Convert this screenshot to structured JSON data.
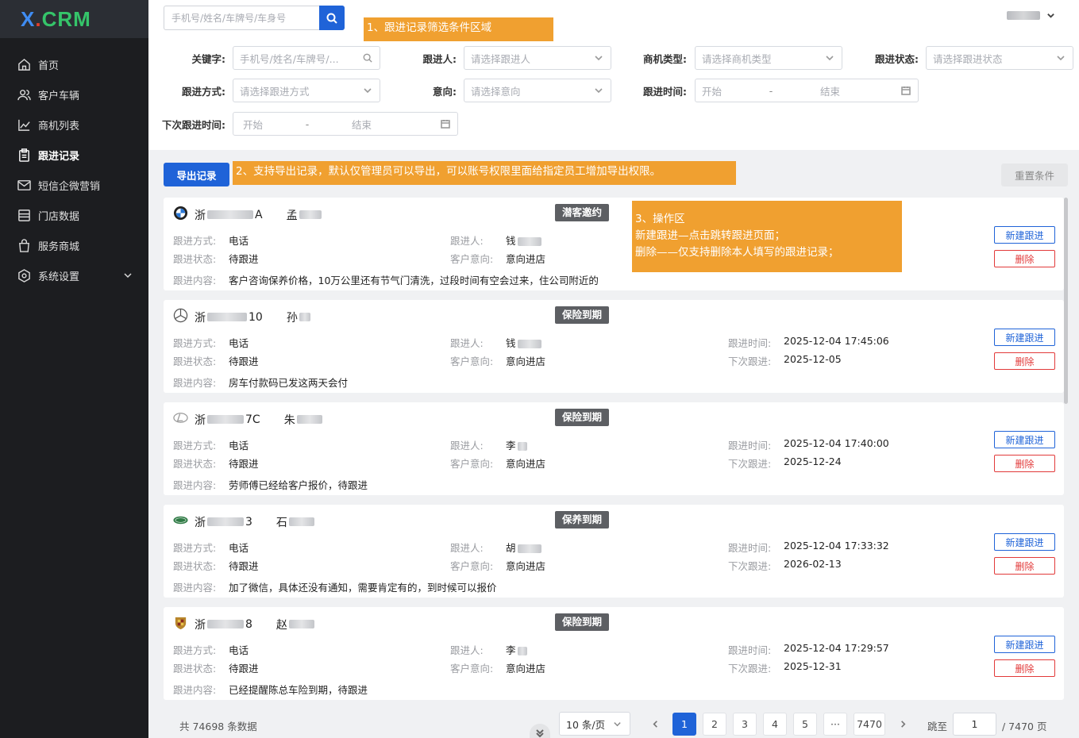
{
  "app": {
    "logo_x": "X",
    "logo_dot": ".",
    "logo_crm": "CRM"
  },
  "sidebar": {
    "items": [
      {
        "label": "首页",
        "icon": "home-icon"
      },
      {
        "label": "客户车辆",
        "icon": "users-icon"
      },
      {
        "label": "商机列表",
        "icon": "chart-icon"
      },
      {
        "label": "跟进记录",
        "icon": "clipboard-icon",
        "active": true
      },
      {
        "label": "短信企微营销",
        "icon": "mail-icon"
      },
      {
        "label": "门店数据",
        "icon": "table-icon"
      },
      {
        "label": "服务商城",
        "icon": "bag-icon"
      },
      {
        "label": "系统设置",
        "icon": "gear-icon"
      }
    ]
  },
  "topbar": {
    "search_placeholder": "手机号/姓名/车牌号/车身号"
  },
  "filters": {
    "keyword_label": "关键字:",
    "keyword_placeholder": "手机号/姓名/车牌号/...",
    "follower_label": "跟进人:",
    "follower_placeholder": "请选择跟进人",
    "opp_type_label": "商机类型:",
    "opp_type_placeholder": "请选择商机类型",
    "status_label": "跟进状态:",
    "status_placeholder": "请选择跟进状态",
    "method_label": "跟进方式:",
    "method_placeholder": "请选择跟进方式",
    "intent_label": "意向:",
    "intent_placeholder": "请选择意向",
    "time_label": "跟进时间:",
    "next_time_label": "下次跟进时间:",
    "start": "开始",
    "dash": "-",
    "end": "结束"
  },
  "annotations": {
    "a1": "1、跟进记录筛选条件区域",
    "a2": "2、支持导出记录，默认仅管理员可以导出，可以账号权限里面给指定员工增加导出权限。",
    "a3_title": "3、操作区",
    "a3_line1": "新建跟进—点击跳转跟进页面；",
    "a3_line2": "删除——仅支持删除本人填写的跟进记录；"
  },
  "toolbar": {
    "export_label": "导出记录",
    "reset_label": "重置条件"
  },
  "labels": {
    "method": "跟进方式:",
    "status": "跟进状态:",
    "content": "跟进内容:",
    "follower": "跟进人:",
    "intent": "客户意向:",
    "time": "跟进时间:",
    "next": "下次跟进:",
    "new_btn": "新建跟进",
    "del_btn": "删除"
  },
  "records": [
    {
      "brand_icon": "bmw-logo-icon",
      "plate_prefix": "浙",
      "plate_suffix": "A",
      "name_prefix": "孟",
      "tag": "潜客邀约",
      "method": "电话",
      "status": "待跟进",
      "follower_prefix": "钱",
      "intent": "意向进店",
      "time": "",
      "next": "",
      "content": "客户咨询保养价格，10万公里还有节气门清洗，过段时间有空会过来，住公司附近的"
    },
    {
      "brand_icon": "mercedes-logo-icon",
      "plate_prefix": "浙",
      "plate_suffix": "10",
      "name_prefix": "孙",
      "tag": "保险到期",
      "method": "电话",
      "status": "待跟进",
      "follower_prefix": "钱",
      "intent": "意向进店",
      "time": "2025-12-04 17:45:06",
      "next": "2025-12-05",
      "content": "房车付款码已发这两天会付"
    },
    {
      "brand_icon": "lexus-logo-icon",
      "plate_prefix": "浙",
      "plate_suffix": "7C",
      "name_prefix": "朱",
      "tag": "保险到期",
      "method": "电话",
      "status": "待跟进",
      "follower_prefix": "李",
      "intent": "意向进店",
      "time": "2025-12-04 17:40:00",
      "next": "2025-12-24",
      "content": "劳师傅已经给客户报价，待跟进"
    },
    {
      "brand_icon": "landrover-logo-icon",
      "plate_prefix": "浙",
      "plate_suffix": "3",
      "name_prefix": "石",
      "tag": "保养到期",
      "method": "电话",
      "status": "待跟进",
      "follower_prefix": "胡",
      "intent": "意向进店",
      "time": "2025-12-04 17:33:32",
      "next": "2026-02-13",
      "content": "加了微信，具体还没有通知，需要肯定有的，到时候可以报价"
    },
    {
      "brand_icon": "porsche-logo-icon",
      "plate_prefix": "浙",
      "plate_suffix": "8",
      "name_prefix": "赵",
      "tag": "保险到期",
      "method": "电话",
      "status": "待跟进",
      "follower_prefix": "李",
      "intent": "意向进店",
      "time": "2025-12-04 17:29:57",
      "next": "2025-12-31",
      "content": "已经提醒陈总车险到期，待跟进"
    }
  ],
  "pagination": {
    "total": "共 74698 条数据",
    "page_size": "10 条/页",
    "pages": [
      "1",
      "2",
      "3",
      "4",
      "5",
      "···",
      "7470"
    ],
    "current": "1",
    "jump_label": "跳至",
    "jump_value": "1",
    "total_pages": "/ 7470 页"
  },
  "colors": {
    "accent": "#1f63d8",
    "danger": "#e23a3a",
    "annotation": "#f0a030",
    "sidebar": "#1c1d20"
  }
}
